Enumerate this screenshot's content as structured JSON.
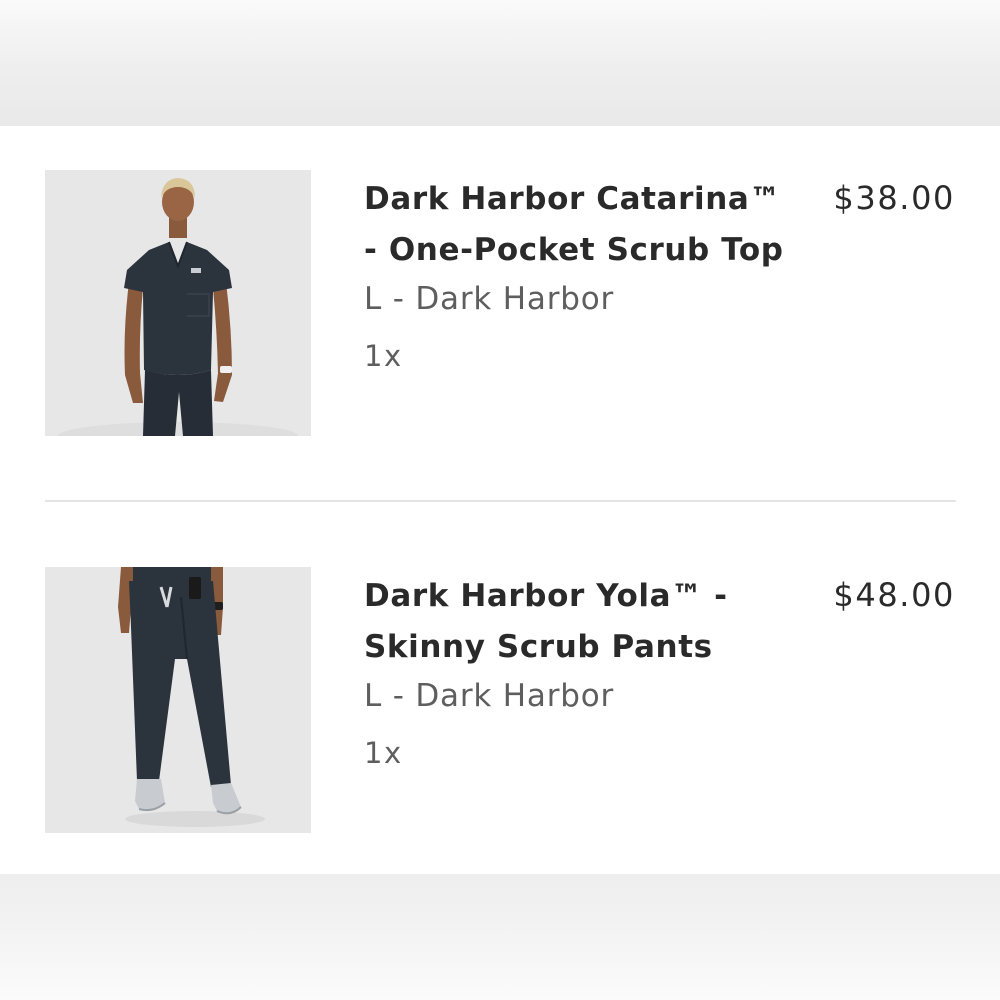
{
  "cart": {
    "items": [
      {
        "name_line1": "Dark Harbor Catarina™",
        "name_line2": "- One-Pocket Scrub Top",
        "variant": "L - Dark Harbor",
        "quantity": "1x",
        "price": "$38.00",
        "image_icon": "scrub-top-photo"
      },
      {
        "name_line1": "Dark Harbor Yola™ -",
        "name_line2": "Skinny Scrub Pants",
        "variant": "L - Dark Harbor",
        "quantity": "1x",
        "price": "$48.00",
        "image_icon": "scrub-pants-photo"
      }
    ]
  },
  "colors": {
    "garment": "#2b333d",
    "image_background": "#e7e7e7",
    "title_text": "#2a2a2a",
    "secondary_text": "#5e5e5e",
    "divider": "#e4e4e4"
  }
}
